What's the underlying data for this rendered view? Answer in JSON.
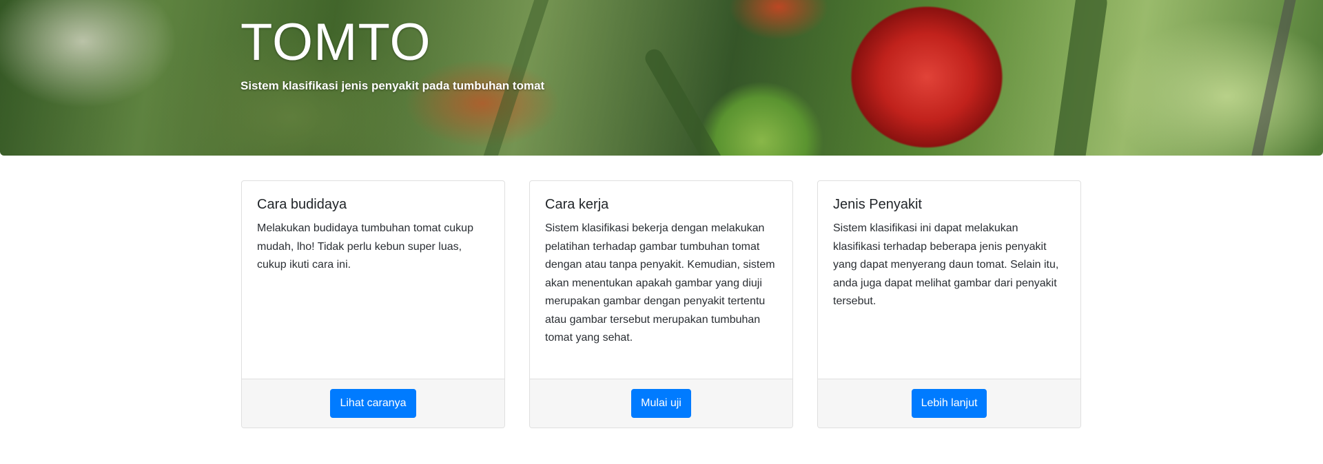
{
  "hero": {
    "title": "TOMTO",
    "subtitle": "Sistem klasifikasi jenis penyakit pada tumbuhan tomat",
    "background_image": "tomato-plant-photo"
  },
  "cards": [
    {
      "title": "Cara budidaya",
      "text": "Melakukan budidaya tumbuhan tomat cukup mudah, lho! Tidak perlu kebun super luas, cukup ikuti cara ini.",
      "button_label": "Lihat caranya"
    },
    {
      "title": "Cara kerja",
      "text": "Sistem klasifikasi bekerja dengan melakukan pelatihan terhadap gambar tumbuhan tomat dengan atau tanpa penyakit. Kemudian, sistem akan menentukan apakah gambar yang diuji merupakan gambar dengan penyakit tertentu atau gambar tersebut merupakan tumbuhan tomat yang sehat.",
      "button_label": "Mulai uji"
    },
    {
      "title": "Jenis Penyakit",
      "text": "Sistem klasifikasi ini dapat melakukan klasifikasi terhadap beberapa jenis penyakit yang dapat menyerang daun tomat. Selain itu, anda juga dapat melihat gambar dari penyakit tersebut.",
      "button_label": "Lebih lanjut"
    }
  ],
  "colors": {
    "primary": "#007bff",
    "card_footer_bg": "#f6f6f6",
    "card_border": "#dfdfdf"
  }
}
